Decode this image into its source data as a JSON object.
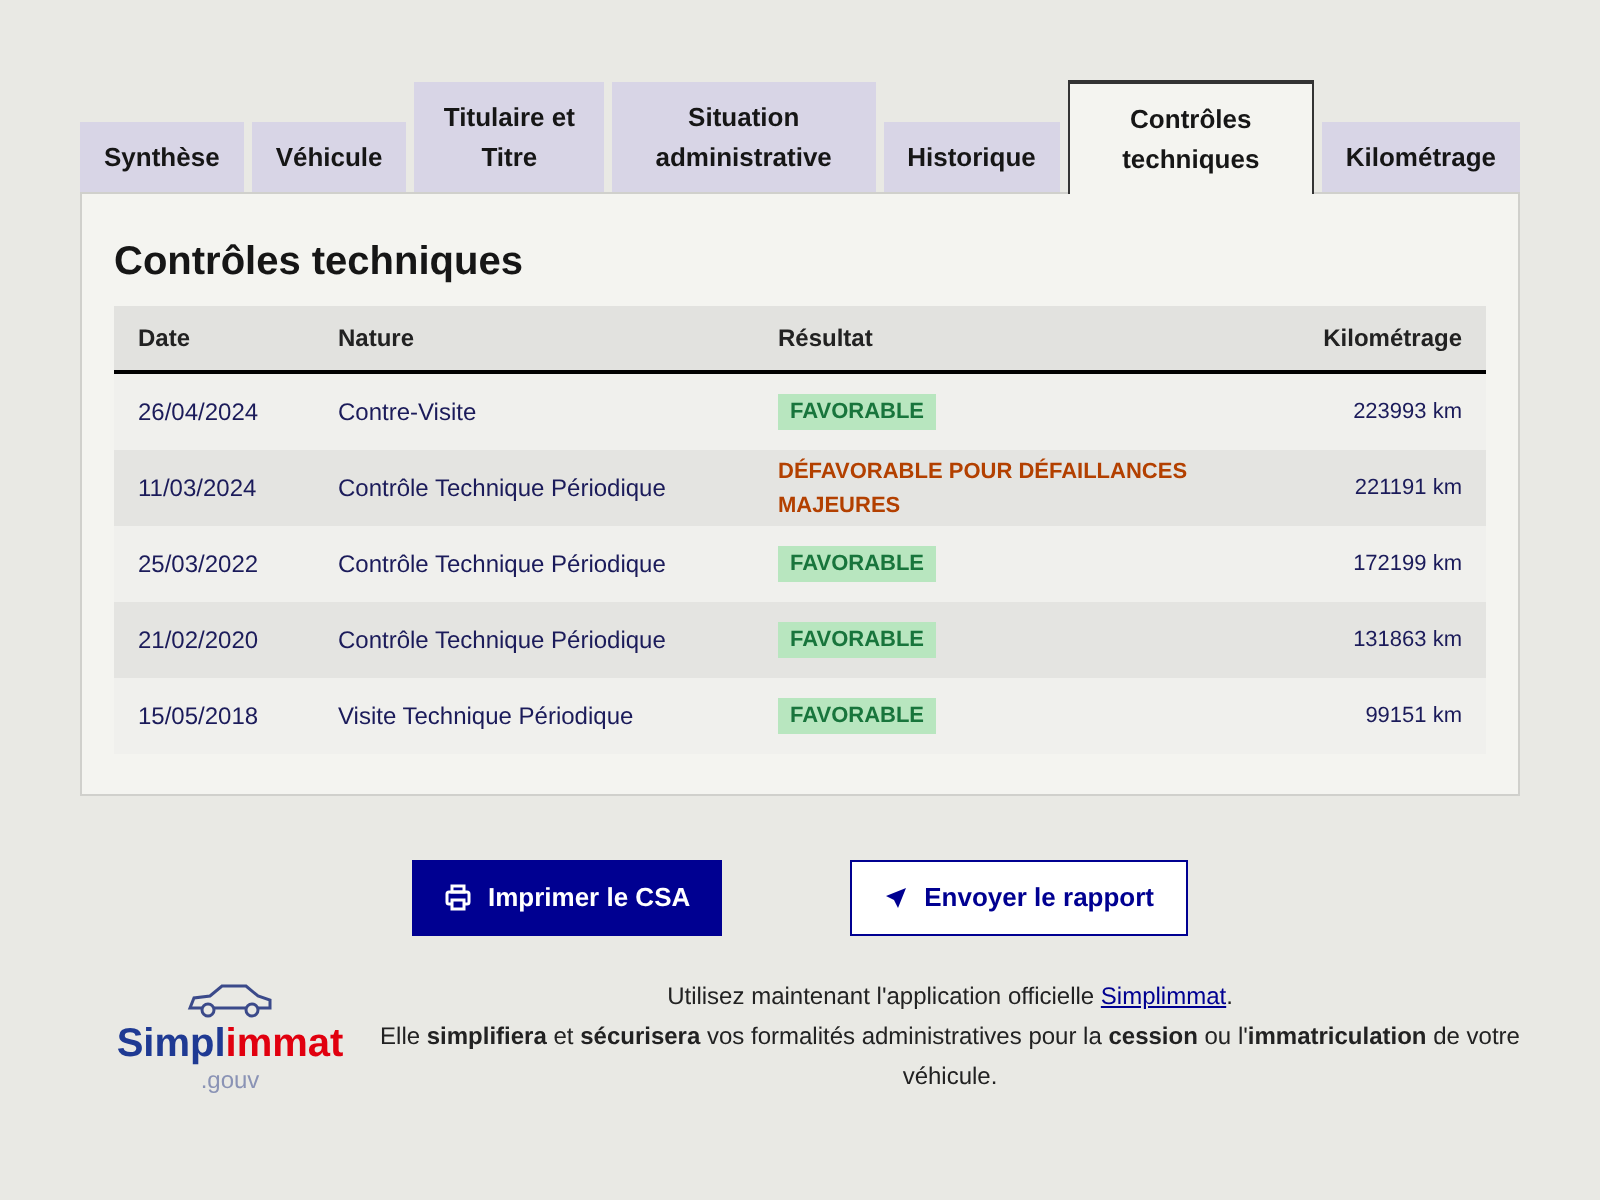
{
  "tabs": [
    {
      "label": "Synthèse",
      "selected": false
    },
    {
      "label": "Véhicule",
      "selected": false
    },
    {
      "label": "Titulaire et Titre",
      "selected": false
    },
    {
      "label": "Situation administrative",
      "selected": false
    },
    {
      "label": "Historique",
      "selected": false
    },
    {
      "label": "Contrôles techniques",
      "selected": true
    },
    {
      "label": "Kilométrage",
      "selected": false
    }
  ],
  "section_title": "Contrôles techniques",
  "table": {
    "columns": [
      "Date",
      "Nature",
      "Résultat",
      "Kilométrage"
    ],
    "rows": [
      {
        "date": "26/04/2024",
        "nature": "Contre-Visite",
        "result": {
          "kind": "favorable",
          "text": "FAVORABLE"
        },
        "mileage": "223993 km"
      },
      {
        "date": "11/03/2024",
        "nature": "Contrôle Technique Périodique",
        "result": {
          "kind": "unfavorable",
          "text": "DÉFAVORABLE POUR DÉFAILLANCES MAJEURES"
        },
        "mileage": "221191 km"
      },
      {
        "date": "25/03/2022",
        "nature": "Contrôle Technique Périodique",
        "result": {
          "kind": "favorable",
          "text": "FAVORABLE"
        },
        "mileage": "172199 km"
      },
      {
        "date": "21/02/2020",
        "nature": "Contrôle Technique Périodique",
        "result": {
          "kind": "favorable",
          "text": "FAVORABLE"
        },
        "mileage": "131863 km"
      },
      {
        "date": "15/05/2018",
        "nature": "Visite Technique Périodique",
        "result": {
          "kind": "favorable",
          "text": "FAVORABLE"
        },
        "mileage": "99151 km"
      }
    ]
  },
  "buttons": [
    {
      "kind": "primary",
      "label": "Imprimer le CSA"
    },
    {
      "kind": "secondary",
      "label": "Envoyer le rapport"
    }
  ],
  "promo": {
    "logo": {
      "part_1": "Simpl",
      "part_2": "immat",
      "suffix": ".gouv"
    },
    "line_1": "Utilisez maintenant l'application officielle",
    "link": "Simplimmat",
    "line_1_end": ".",
    "line_2": "Elle **simplifiera** et **sécurisera** vos formalités administratives pour la **cession** ou l'**immatriculation** de votre véhicule."
  }
}
